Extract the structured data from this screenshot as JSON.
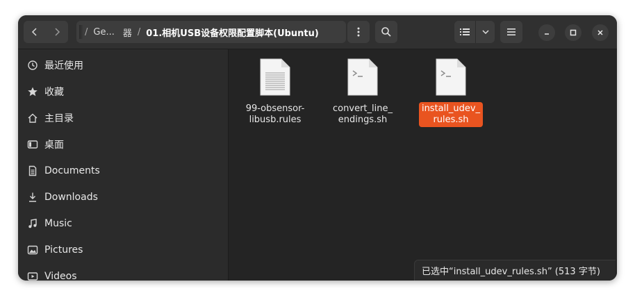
{
  "header": {
    "back_label": "Back",
    "forward_label": "Forward",
    "path": {
      "truncated_segment": "Ge...",
      "middle_segment": "器",
      "current": "01.相机USB设备权限配置脚本(Ubuntu)"
    }
  },
  "sidebar": {
    "items": [
      {
        "label": "最近使用",
        "icon": "clock-icon"
      },
      {
        "label": "收藏",
        "icon": "star-icon"
      },
      {
        "label": "主目录",
        "icon": "home-icon"
      },
      {
        "label": "桌面",
        "icon": "desktop-icon"
      },
      {
        "label": "Documents",
        "icon": "document-icon"
      },
      {
        "label": "Downloads",
        "icon": "download-icon"
      },
      {
        "label": "Music",
        "icon": "music-icon"
      },
      {
        "label": "Pictures",
        "icon": "picture-icon"
      },
      {
        "label": "Videos",
        "icon": "video-icon"
      }
    ]
  },
  "files": [
    {
      "name": "99-obsensor-\nlibusb.rules",
      "type": "text-file-icon",
      "selected": false
    },
    {
      "name": "convert_line_\nendings.sh",
      "type": "script-file-icon",
      "selected": false
    },
    {
      "name": "install_udev_\nrules.sh",
      "type": "script-file-icon",
      "selected": true
    }
  ],
  "status": {
    "text": "已选中“install_udev_rules.sh” (513 字节)"
  },
  "colors": {
    "accent": "#e95420",
    "window_bg": "#242424",
    "sidebar_bg": "#2b2b2b",
    "header_bg": "#303030"
  }
}
